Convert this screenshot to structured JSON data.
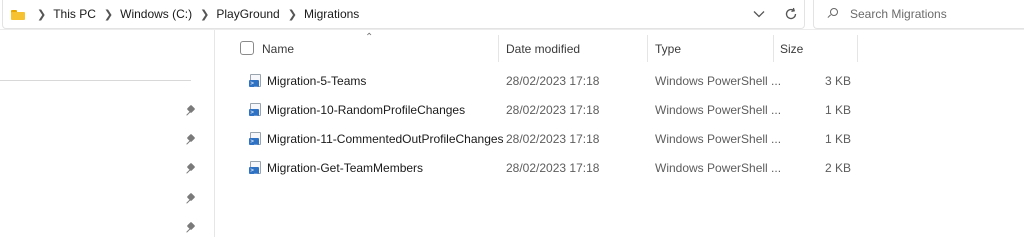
{
  "address_bar": {
    "breadcrumbs": [
      "This PC",
      "Windows (C:)",
      "PlayGround",
      "Migrations"
    ]
  },
  "search": {
    "placeholder": "Search Migrations",
    "value": ""
  },
  "columns": {
    "name": "Name",
    "date_modified": "Date modified",
    "type": "Type",
    "size": "Size"
  },
  "files": [
    {
      "name": "Migration-5-Teams",
      "date_modified": "28/02/2023 17:18",
      "type": "Windows PowerShell ...",
      "size": "3 KB"
    },
    {
      "name": "Migration-10-RandomProfileChanges",
      "date_modified": "28/02/2023 17:18",
      "type": "Windows PowerShell ...",
      "size": "1 KB"
    },
    {
      "name": "Migration-11-CommentedOutProfileChanges",
      "date_modified": "28/02/2023 17:18",
      "type": "Windows PowerShell ...",
      "size": "1 KB"
    },
    {
      "name": "Migration-Get-TeamMembers",
      "date_modified": "28/02/2023 17:18",
      "type": "Windows PowerShell ...",
      "size": "2 KB"
    }
  ],
  "icons": {
    "folder": "folder-icon",
    "breadcrumb_separator": "chevron-right-icon",
    "history": "chevron-down-icon",
    "refresh": "refresh-icon",
    "search": "search-icon",
    "pin": "pin-icon",
    "file": "powershell-script-icon",
    "sort": "sort-ascending-icon"
  },
  "colors": {
    "folder": "#f6c231",
    "powershell_badge": "#2f72c4",
    "muted_text": "#5d5d5d"
  }
}
